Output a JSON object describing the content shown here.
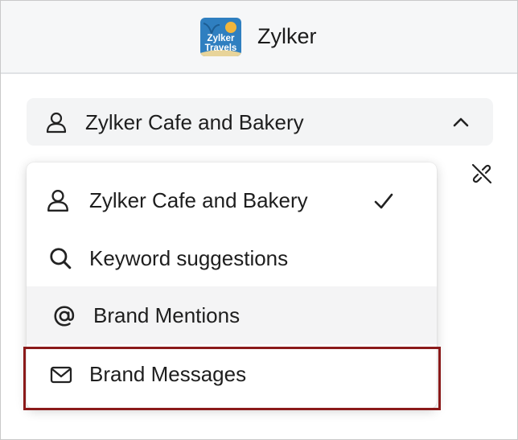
{
  "header": {
    "logo_text": [
      "Zylker",
      "Travels"
    ],
    "brand_name": "Zylker"
  },
  "selector": {
    "current_label": "Zylker Cafe and Bakery",
    "icon": "user-icon",
    "expanded": true
  },
  "dropdown": {
    "items": [
      {
        "label": "Zylker Cafe and Bakery",
        "icon": "user-icon",
        "selected": true
      },
      {
        "label": "Keyword suggestions",
        "icon": "search-icon",
        "selected": false
      },
      {
        "label": "Brand Mentions",
        "icon": "at-sign-icon",
        "selected": false,
        "hovered": true
      },
      {
        "label": "Brand Messages",
        "icon": "envelope-icon",
        "selected": false,
        "highlighted": true
      }
    ]
  },
  "colors": {
    "header_bg": "#f6f7f8",
    "selector_bg": "#f3f4f5",
    "hover_bg": "#f4f4f5",
    "highlight_border": "#8b1a1a",
    "logo_bg": "#2f7fc0",
    "text": "#1e1e1e"
  }
}
